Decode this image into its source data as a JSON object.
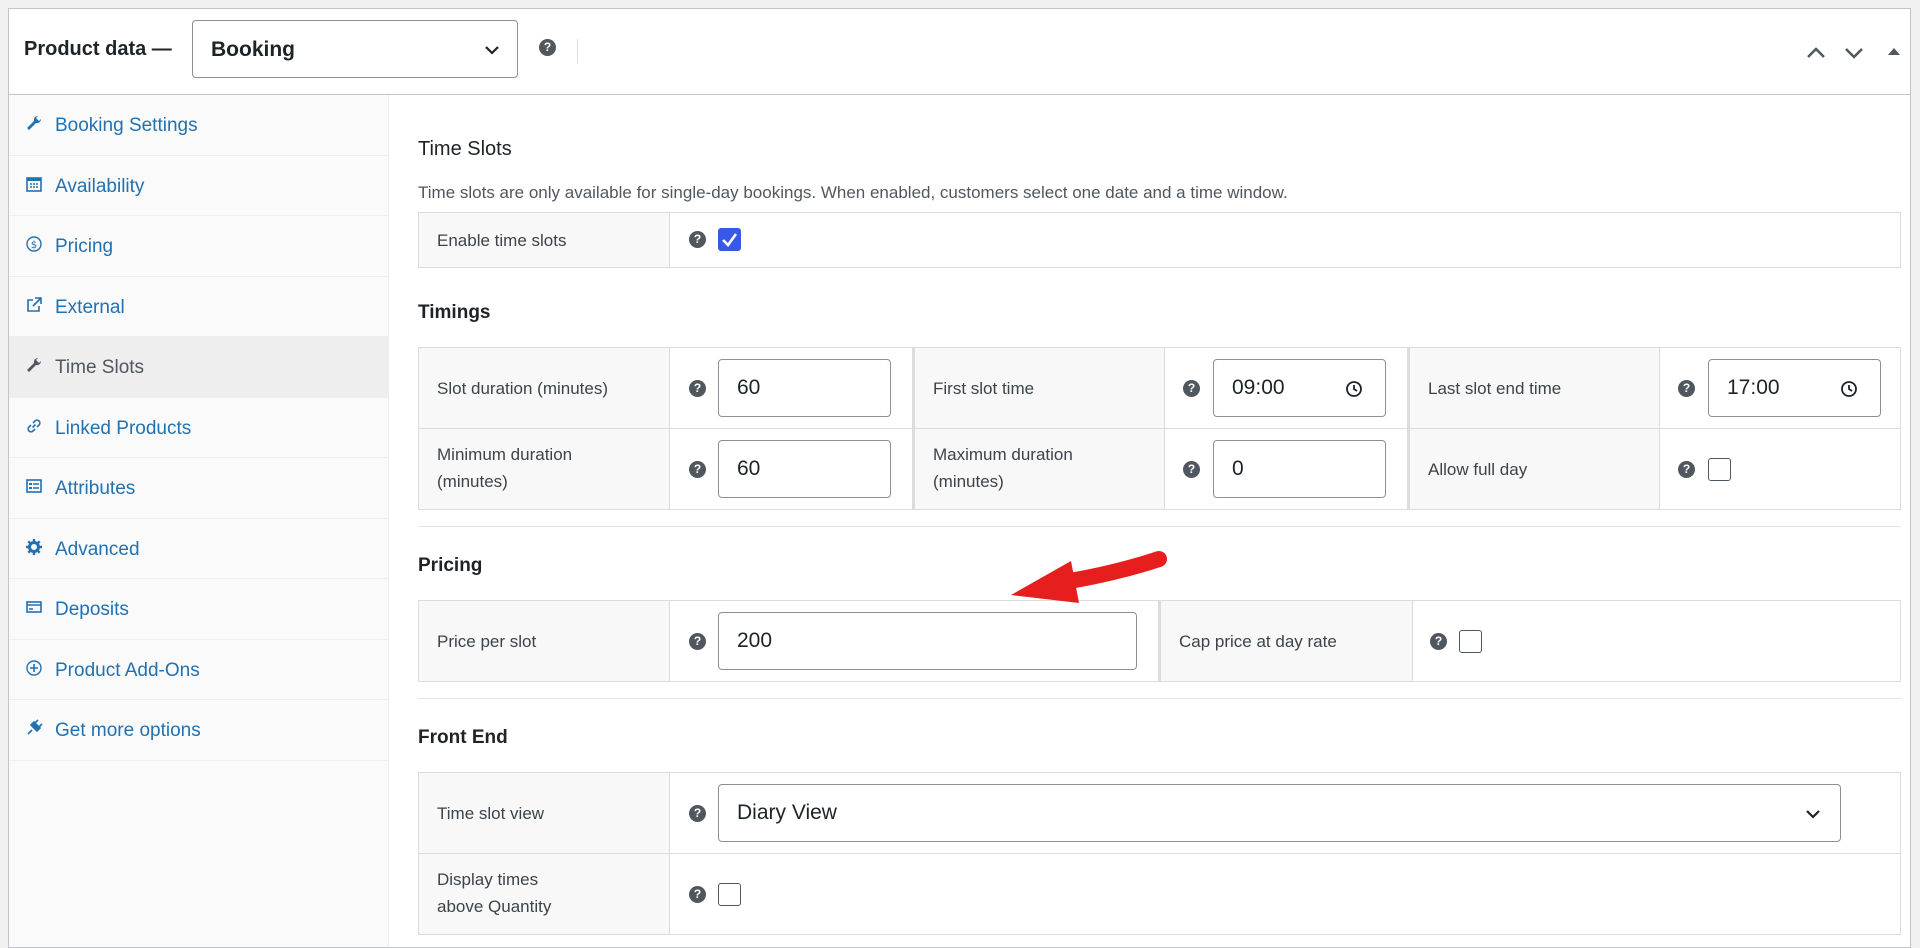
{
  "header": {
    "title": "Product data —",
    "product_type": "Booking",
    "help_glyph": "?"
  },
  "sidebar": {
    "items": [
      {
        "label": "Booking Settings",
        "icon": "wrench-icon"
      },
      {
        "label": "Availability",
        "icon": "calendar-icon"
      },
      {
        "label": "Pricing",
        "icon": "dollar-icon"
      },
      {
        "label": "External",
        "icon": "external-link-icon"
      },
      {
        "label": "Time Slots",
        "icon": "wrench-icon"
      },
      {
        "label": "Linked Products",
        "icon": "link-icon"
      },
      {
        "label": "Attributes",
        "icon": "list-icon"
      },
      {
        "label": "Advanced",
        "icon": "gear-icon"
      },
      {
        "label": "Deposits",
        "icon": "card-icon"
      },
      {
        "label": "Product Add-Ons",
        "icon": "plus-circle-icon"
      },
      {
        "label": "Get more options",
        "icon": "plugin-icon"
      }
    ],
    "active": "Time Slots"
  },
  "time_slots": {
    "title": "Time Slots",
    "description": "Time slots are only available for single-day bookings. When enabled, customers select one date and a time window.",
    "enable_label": "Enable time slots",
    "enable_checked": true
  },
  "timings": {
    "title": "Timings",
    "slot_duration_label": "Slot duration (minutes)",
    "slot_duration_value": "60",
    "first_slot_label": "First slot time",
    "first_slot_value": "09:00",
    "last_slot_label": "Last slot end time",
    "last_slot_value": "17:00",
    "min_duration_label_1": "Minimum duration",
    "min_duration_label_2": "(minutes)",
    "min_duration_value": "60",
    "max_duration_label_1": "Maximum duration",
    "max_duration_label_2": "(minutes)",
    "max_duration_value": "0",
    "allow_full_day_label": "Allow full day",
    "allow_full_day_checked": false
  },
  "pricing": {
    "title": "Pricing",
    "price_per_slot_label": "Price per slot",
    "price_per_slot_value": "200",
    "cap_label": "Cap price at day rate",
    "cap_checked": false
  },
  "front_end": {
    "title": "Front End",
    "view_label": "Time slot view",
    "view_value": "Diary View",
    "display_label_1": "Display times",
    "display_label_2": "above Quantity",
    "display_checked": false
  },
  "colors": {
    "link": "#2271b1",
    "checkbox_accent": "#3858e9",
    "annotation_arrow": "#e61e1e"
  }
}
